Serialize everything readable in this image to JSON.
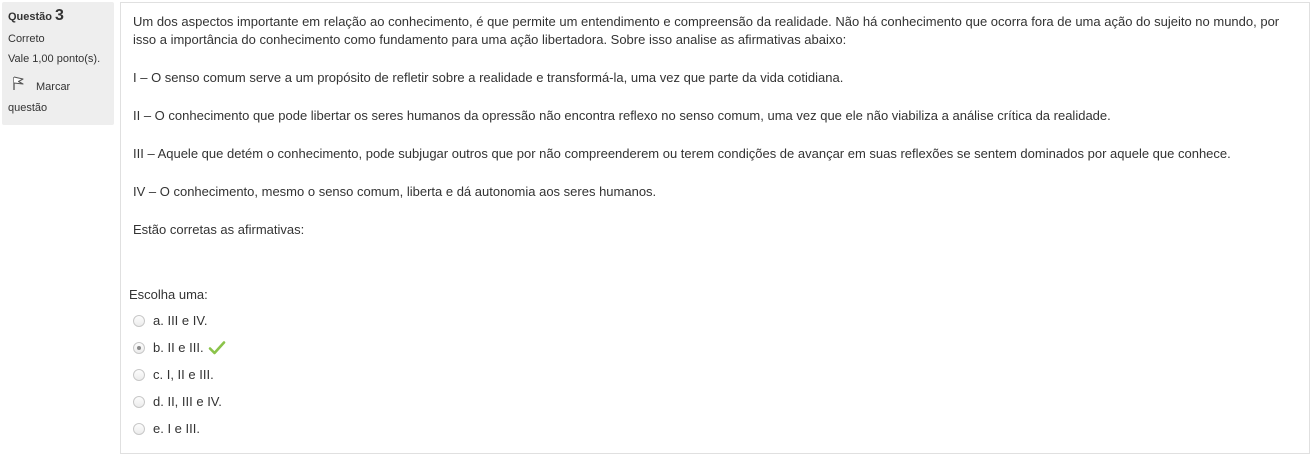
{
  "info": {
    "question_label": "Questão",
    "question_number": "3",
    "state": "Correto",
    "grade": "Vale 1,00 ponto(s).",
    "flag_label_line1": "Marcar",
    "flag_label_line2": "questão"
  },
  "question": {
    "paragraphs": [
      "Um dos aspectos importante em relação ao conhecimento, é que permite um entendimento e compreensão da realidade. Não há conhecimento que ocorra fora de uma ação do sujeito no mundo, por isso a importância do conhecimento como fundamento para uma ação libertadora. Sobre isso analise as afirmativas abaixo:",
      "I – O senso comum serve a um propósito de refletir sobre a realidade e transformá-la, uma vez que parte da vida cotidiana.",
      "II – O conhecimento que pode libertar os seres humanos da opressão não encontra reflexo no senso comum, uma vez que ele não viabiliza a análise crítica da realidade.",
      "III – Aquele que detém o conhecimento, pode subjugar outros que por não compreenderem ou terem condições de avançar em suas reflexões se sentem dominados por aquele que conhece.",
      "IV – O conhecimento, mesmo o senso comum, liberta e dá autonomia aos seres humanos.",
      "Estão corretas as afirmativas:"
    ],
    "prompt": "Escolha uma:",
    "options": [
      {
        "label": "a. III e IV.",
        "checked": false,
        "correct": false
      },
      {
        "label": "b. II e III.",
        "checked": true,
        "correct": true
      },
      {
        "label": "c. I, II e III.",
        "checked": false,
        "correct": false
      },
      {
        "label": "d. II, III e IV.",
        "checked": false,
        "correct": false
      },
      {
        "label": "e. I e III.",
        "checked": false,
        "correct": false
      }
    ]
  },
  "icons": {
    "flag": "flag-icon",
    "correct": "checkmark-icon"
  },
  "colors": {
    "info_bg": "#eeeeee",
    "correct_check": "#8bc34a",
    "border": "#e0e0e0"
  }
}
